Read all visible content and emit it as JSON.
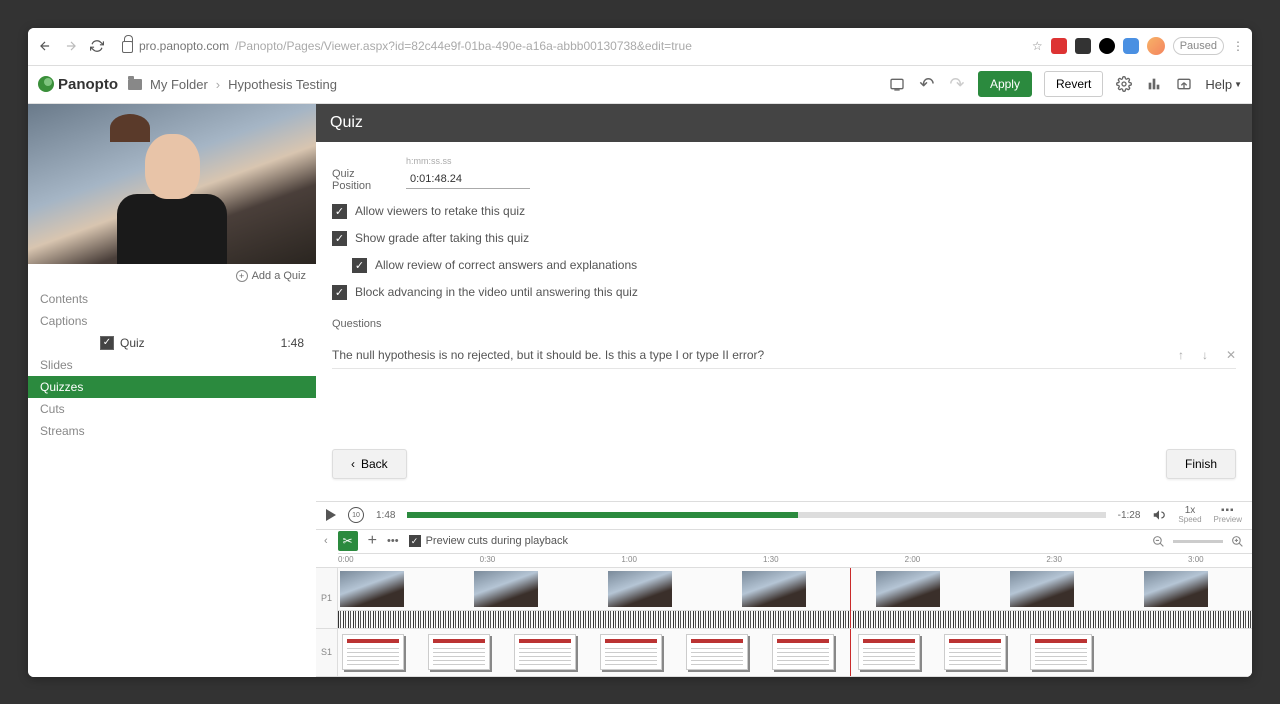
{
  "chrome": {
    "url_host": "pro.panopto.com",
    "url_path": "/Panopto/Pages/Viewer.aspx?id=82c44e9f-01ba-490e-a16a-abbb00130738&edit=true",
    "paused": "Paused"
  },
  "app": {
    "logo": "Panopto",
    "folder_icon_label": "My Folder",
    "breadcrumb_title": "Hypothesis Testing",
    "undo": "↶",
    "redo": "↷",
    "apply": "Apply",
    "revert": "Revert",
    "help": "Help"
  },
  "side": {
    "add_quiz": "Add a Quiz",
    "tabs": {
      "contents": "Contents",
      "captions": "Captions",
      "slides": "Slides",
      "quizzes": "Quizzes",
      "cuts": "Cuts",
      "streams": "Streams"
    },
    "quiz_item": {
      "label": "Quiz",
      "time": "1:48"
    }
  },
  "quiz": {
    "header": "Quiz",
    "position_hint": "h:mm:ss.ss",
    "position_label": "Quiz Position",
    "position_value": "0:01:48.24",
    "opts": {
      "retake": "Allow viewers to retake this quiz",
      "show_grade": "Show grade after taking this quiz",
      "review": "Allow review of correct answers and explanations",
      "block": "Block advancing in the video until answering this quiz"
    },
    "questions_label": "Questions",
    "question_text": "The null hypothesis is no rejected, but it should be. Is this a type I or type II error?",
    "back": "Back",
    "finish": "Finish"
  },
  "player": {
    "current": "1:48",
    "remaining": "-1:28",
    "speed": "1x",
    "speed_label": "Speed",
    "preview_label": "Preview",
    "preview_cuts": "Preview cuts during playback"
  },
  "ruler": {
    "t0": "0:00",
    "t1": "0:30",
    "t2": "1:00",
    "t3": "1:30",
    "t4": "2:00",
    "t5": "2:30",
    "t6": "3:00"
  },
  "tracks": {
    "p1": "P1",
    "s1": "S1"
  }
}
